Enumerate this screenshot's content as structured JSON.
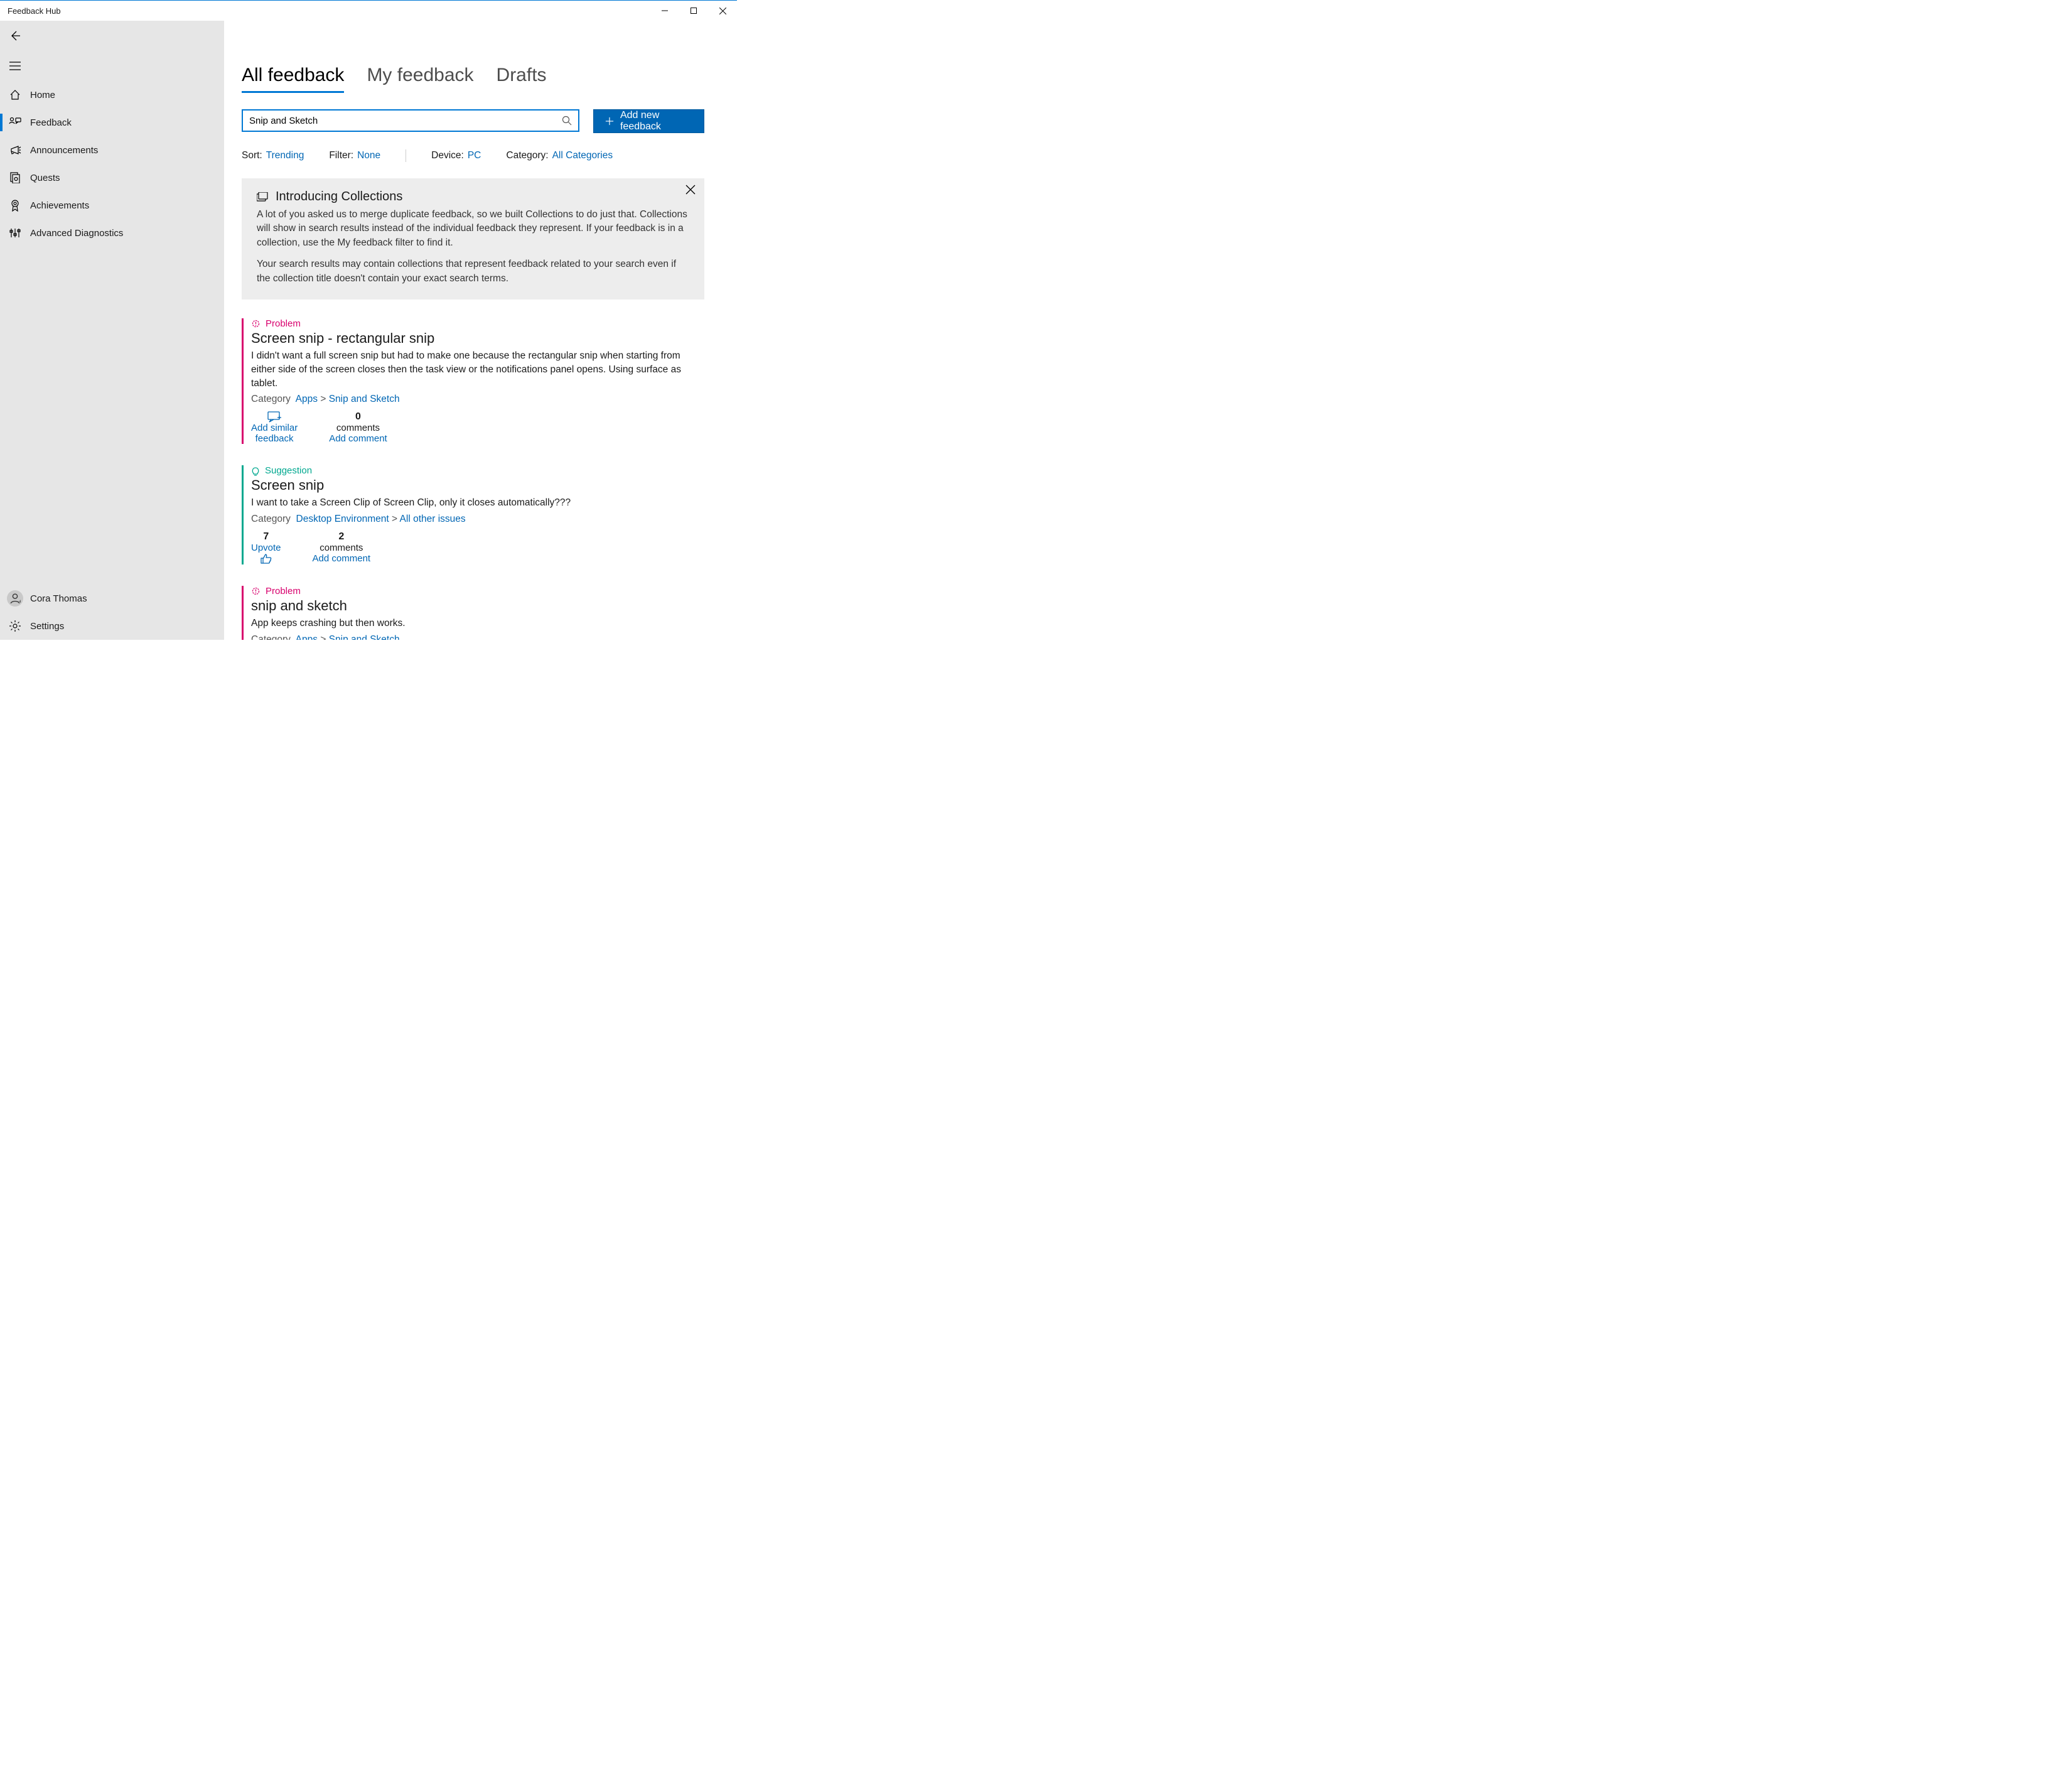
{
  "window": {
    "title": "Feedback Hub"
  },
  "sidebar": {
    "nav": [
      {
        "label": "Home",
        "icon": "home"
      },
      {
        "label": "Feedback",
        "icon": "feedback",
        "active": true
      },
      {
        "label": "Announcements",
        "icon": "megaphone"
      },
      {
        "label": "Quests",
        "icon": "quest"
      },
      {
        "label": "Achievements",
        "icon": "ribbon"
      },
      {
        "label": "Advanced Diagnostics",
        "icon": "diag"
      }
    ],
    "footer": {
      "user": "Cora Thomas",
      "settings": "Settings"
    }
  },
  "tabs": [
    {
      "label": "All feedback",
      "active": true
    },
    {
      "label": "My feedback"
    },
    {
      "label": "Drafts"
    }
  ],
  "search": {
    "value": "Snip and Sketch"
  },
  "add_button": "Add new feedback",
  "filterbar": {
    "sort_label": "Sort:",
    "sort_value": "Trending",
    "filter_label": "Filter:",
    "filter_value": "None",
    "device_label": "Device:",
    "device_value": "PC",
    "category_label": "Category:",
    "category_value": "All Categories"
  },
  "banner": {
    "title": "Introducing Collections",
    "p1": "A lot of you asked us to merge duplicate feedback, so we built Collections to do just that. Collections will show in search results instead of the individual feedback they represent. If your feedback is in a collection, use the My feedback filter to find it.",
    "p2": "Your search results may contain collections that represent feedback related to your search even if the collection title doesn't contain your exact search terms."
  },
  "labels": {
    "problem": "Problem",
    "suggestion": "Suggestion",
    "category": "Category",
    "add_similar": "Add similar feedback",
    "upvote": "Upvote",
    "comments": "comments",
    "add_comment": "Add comment"
  },
  "feedback": [
    {
      "type": "problem",
      "title": "Screen snip - rectangular snip",
      "desc": "I didn't want a full screen snip but had to make one because the rectangular snip when starting from either side of the screen closes then the task view or the notifications panel opens. Using surface as tablet.",
      "cat1": "Apps",
      "cat2": "Snip and Sketch",
      "action_mode": "add_similar",
      "comment_count": "0"
    },
    {
      "type": "suggestion",
      "title": "Screen snip",
      "desc": "I want to take a Screen Clip of Screen Clip, only it closes automatically???",
      "cat1": "Desktop Environment",
      "cat2": "All other issues",
      "action_mode": "upvote",
      "upvotes": "7",
      "comment_count": "2"
    },
    {
      "type": "problem",
      "title": "snip and sketch",
      "desc": "App keeps crashing but then works.",
      "cat1": "Apps",
      "cat2": "Snip and Sketch",
      "action_mode": "none",
      "partial": true
    }
  ]
}
